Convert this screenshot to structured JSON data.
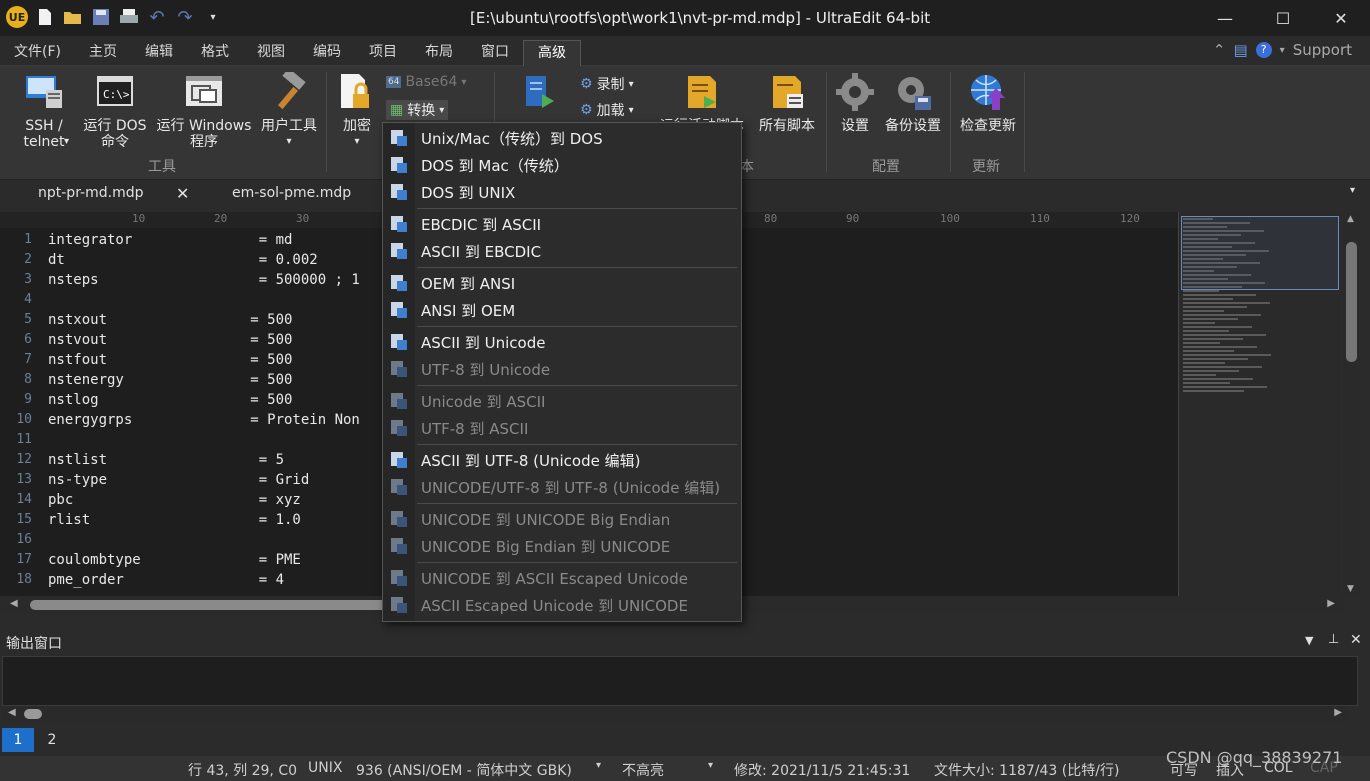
{
  "window": {
    "title": "[E:\\ubuntu\\rootfs\\opt\\work1\\nvt-pr-md.mdp] - UltraEdit 64-bit",
    "minimize": "—",
    "maximize": "☐",
    "close": "✕"
  },
  "menu": {
    "tabs": [
      "文件(F)",
      "主页",
      "编辑",
      "格式",
      "视图",
      "编码",
      "项目",
      "布局",
      "窗口",
      "高级"
    ],
    "active_tab": "高级",
    "support": "Support"
  },
  "ribbon": {
    "ssh": "SSH /\ntelnet",
    "run_dos": "运行 DOS\n命令",
    "run_windows": "运行 Windows\n程序",
    "user_tools": "用户工具",
    "tools_group": "工具",
    "encrypt": "加密",
    "base64": "Base64",
    "convert": "转换",
    "record": "录制",
    "load": "加载",
    "run_active_script": "运行活动脚本",
    "all_scripts": "所有脚本",
    "script_group": "本",
    "settings": "设置",
    "backup_settings": "备份设置",
    "config_group": "配置",
    "check_update": "检查更新",
    "update_group": "更新"
  },
  "doc_tabs": [
    "npt-pr-md.mdp",
    "em-sol-pme.mdp"
  ],
  "ruler": {
    "marks": [
      "10",
      "20",
      "30",
      "80",
      "90",
      "100",
      "110",
      "120"
    ]
  },
  "editor": {
    "lines": [
      {
        "n": "1",
        "text": "integrator               = md"
      },
      {
        "n": "2",
        "text": "dt                       = 0.002"
      },
      {
        "n": "3",
        "text": "nsteps                   = 500000 ; 1"
      },
      {
        "n": "4",
        "text": ""
      },
      {
        "n": "5",
        "text": "nstxout                 = 500"
      },
      {
        "n": "6",
        "text": "nstvout                 = 500"
      },
      {
        "n": "7",
        "text": "nstfout                 = 500"
      },
      {
        "n": "8",
        "text": "nstenergy               = 500"
      },
      {
        "n": "9",
        "text": "nstlog                  = 500"
      },
      {
        "n": "10",
        "text": "energygrps              = Protein Non"
      },
      {
        "n": "11",
        "text": ""
      },
      {
        "n": "12",
        "text": "nstlist                  = 5"
      },
      {
        "n": "13",
        "text": "ns-type                  = Grid"
      },
      {
        "n": "14",
        "text": "pbc                      = xyz"
      },
      {
        "n": "15",
        "text": "rlist                    = 1.0"
      },
      {
        "n": "16",
        "text": ""
      },
      {
        "n": "17",
        "text": "coulombtype              = PME"
      },
      {
        "n": "18",
        "text": "pme_order                = 4"
      }
    ]
  },
  "convert_menu": {
    "items": [
      {
        "label": "Unix/Mac（传统）到 DOS",
        "enabled": true,
        "icon": "unix-to-dos-icon"
      },
      {
        "label": "DOS 到 Mac（传统）",
        "enabled": true,
        "icon": "dos-to-mac-icon"
      },
      {
        "label": "DOS 到 UNIX",
        "enabled": true,
        "icon": "dos-to-unix-icon"
      },
      {
        "label": "EBCDIC 到 ASCII",
        "enabled": true,
        "icon": "ebcdic-to-ascii-icon"
      },
      {
        "label": "ASCII 到 EBCDIC",
        "enabled": true,
        "icon": "ascii-to-ebcdic-icon"
      },
      {
        "label": "OEM 到 ANSI",
        "enabled": true,
        "icon": "oem-to-ansi-icon"
      },
      {
        "label": "ANSI 到 OEM",
        "enabled": true,
        "icon": "ansi-to-oem-icon"
      },
      {
        "label": "ASCII 到 Unicode",
        "enabled": true,
        "icon": "ascii-to-unicode-icon"
      },
      {
        "label": "UTF-8 到 Unicode",
        "enabled": false,
        "icon": "utf8-to-unicode-icon"
      },
      {
        "label": "Unicode 到 ASCII",
        "enabled": false,
        "icon": "unicode-to-ascii-icon"
      },
      {
        "label": "UTF-8 到 ASCII",
        "enabled": false,
        "icon": "utf8-to-ascii-icon"
      },
      {
        "label": "ASCII 到 UTF-8 (Unicode 编辑)",
        "enabled": true,
        "icon": "ascii-to-utf8-icon"
      },
      {
        "label": "UNICODE/UTF-8 到 UTF-8 (Unicode 编辑)",
        "enabled": false,
        "icon": "unicode-to-utf8-icon"
      },
      {
        "label": "UNICODE 到 UNICODE Big Endian",
        "enabled": false,
        "icon": "unicode-to-bigendian-icon"
      },
      {
        "label": "UNICODE Big Endian 到 UNICODE",
        "enabled": false,
        "icon": "bigendian-to-unicode-icon"
      },
      {
        "label": "UNICODE 到 ASCII Escaped Unicode",
        "enabled": false,
        "icon": "unicode-to-escaped-icon"
      },
      {
        "label": "ASCII Escaped Unicode 到 UNICODE",
        "enabled": false,
        "icon": "escaped-to-unicode-icon"
      }
    ]
  },
  "output": {
    "title": "输出窗口",
    "tabs": [
      "1",
      "2"
    ]
  },
  "status": {
    "position": "行 43, 列 29, C0",
    "line_ending": "UNIX",
    "codepage": "936  (ANSI/OEM - 简体中文 GBK)",
    "highlight": "不高亮",
    "modified": "修改:  2021/11/5 21:45:31",
    "filesize": "文件大小:  1187/43  (比特/行)",
    "writable": "可写",
    "insert": "插入",
    "col": "COL",
    "cap": "CAP"
  },
  "watermark": "CSDN @qq_38839271",
  "colors": {
    "accent": "#1e6fc9",
    "background": "#2b2b2b",
    "editor_bg": "#1e1e1e"
  }
}
